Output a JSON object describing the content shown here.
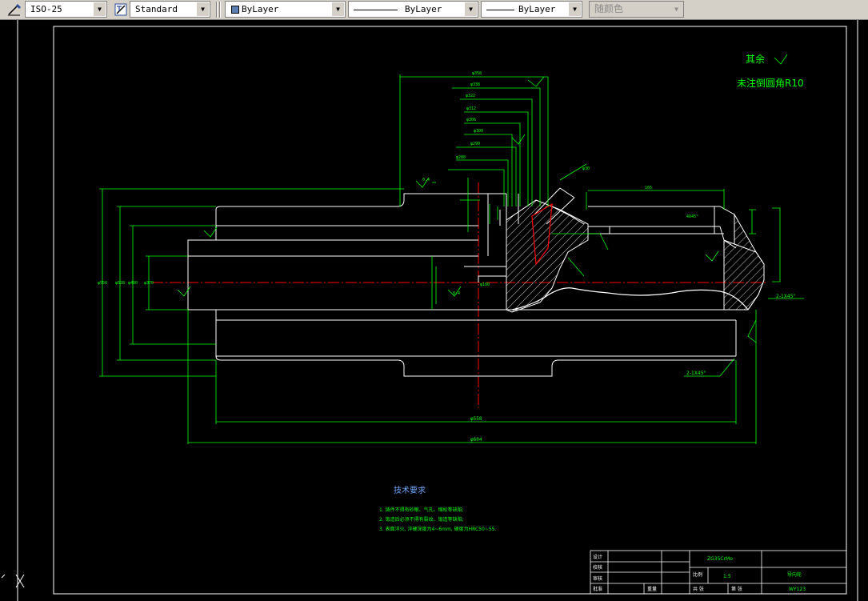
{
  "toolbar": {
    "dimstyle": {
      "value": "ISO-25"
    },
    "textstyle": {
      "value": "Standard"
    },
    "layer_color": {
      "value": "ByLayer"
    },
    "linetype": {
      "value": "ByLayer"
    },
    "lineweight": {
      "value": "ByLayer"
    },
    "plotstyle": {
      "value": "随颜色"
    }
  },
  "drawing": {
    "note_rest": "其余",
    "note_fillet": "未注倒圆角R10",
    "tech_title": "技术要求",
    "tech_lines": [
      "1. 铸件不得有砂眼、气孔、缩松等缺陷;",
      "2. 锻造后必须不得有裂纹、锻造等缺陷;",
      "3. 表面淬火, 淬硬深度为4~6mm, 硬度为HRC50~55."
    ],
    "chamfer_top": "2-1X45°",
    "chamfer_bottom": "2-1X45°",
    "chamfer_inner": "4X45°",
    "dim_bottom_1": "φ558",
    "dim_bottom_2": "φ604",
    "dim_top_1": "φ358",
    "dim_left": "φ558"
  },
  "title_block": {
    "labels": [
      "设计",
      "校核",
      "审核",
      "批准"
    ],
    "label_scale": "比例",
    "scale_value": "1:5",
    "label_total": "共 张",
    "label_sheet": "第 张",
    "label_weight": "重量",
    "material": "ZG35CrMo",
    "part_name": "导向轮",
    "drawing_no": "WY123"
  },
  "ui_colors": {
    "background": "#000000",
    "geometry": "#ffffff",
    "dimension": "#00ff00",
    "centerline": "#ff0000",
    "hatch": "#ffffff"
  }
}
